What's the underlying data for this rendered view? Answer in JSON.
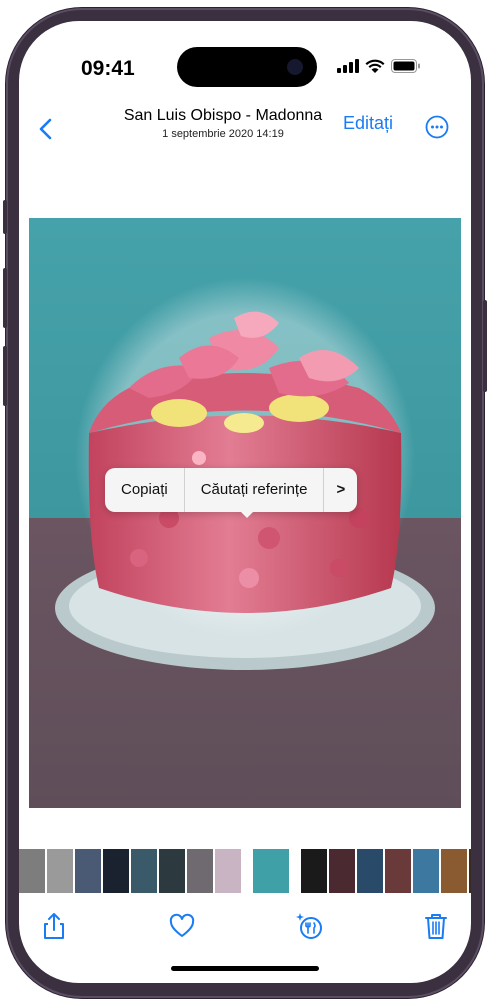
{
  "status_bar": {
    "time": "09:41"
  },
  "nav": {
    "title": "San Luis Obispo - Madonna",
    "subtitle": "1 septembrie 2020  14:19",
    "edit_label": "Editați"
  },
  "context_menu": {
    "items": [
      "Copiați",
      "Căutați referințe",
      ">"
    ]
  },
  "thumbnails": [
    "#7d7d7d",
    "#9a9a9a",
    "#4a5a74",
    "#1a2230",
    "#3a5a6a",
    "#2c3a40",
    "#6f6a70",
    "#c9b4c4",
    "#3fa0a8",
    "#1a1a1a",
    "#4a2a30",
    "#2a4a6a",
    "#6a3a3a",
    "#3c78a0",
    "#8a5a30",
    "#3a2a20",
    "#5a3a20",
    "#2a2a2a",
    "#5a4a30"
  ],
  "toolbar": {
    "share": "share-icon",
    "favorite": "heart-icon",
    "visual_lookup": "visual-lookup-icon",
    "delete": "trash-icon"
  },
  "colors": {
    "accent": "#1a7cf5"
  }
}
